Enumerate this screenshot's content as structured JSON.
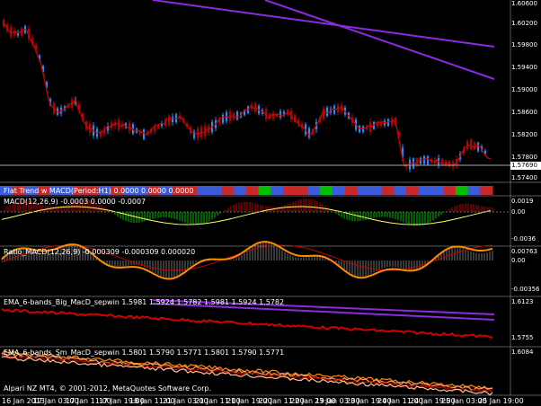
{
  "colors": {
    "background": "#000000",
    "grid": "#5a5a5a",
    "candle_up": "#1e90ff",
    "candle_down": "#b40000",
    "ma_line": "#d00000",
    "ema_band": "#8a2be2",
    "macd_hist_up": "#00c000",
    "macd_hist_down": "#c00000",
    "macd_signal": "#ffff60",
    "ratio_line": "#ff8c00",
    "ratio_signal": "#c00000",
    "flat_trend_blue": "#3c5adc",
    "flat_trend_red": "#c82828",
    "flat_trend_green": "#00c000"
  },
  "main_panel": {
    "price_scale": [
      "1.60600",
      "1.60200",
      "1.59800",
      "1.59400",
      "1.59000",
      "1.58600",
      "1.58200",
      "1.57800",
      "1.57400"
    ],
    "current_price": "1.57690"
  },
  "indicators": {
    "flat_trend": {
      "label": "Flat Trend w MACD(Period:H1) 0.0000 0.0000 0.0000"
    },
    "macd": {
      "label": "MACD(12,26,9) -0.0003 0.0000 -0.0007",
      "scale": [
        "0.0019",
        "0.00",
        "-0.0036"
      ]
    },
    "ratio_macd": {
      "label": "Ratio_MACD(12,26,9) -0.000309 -0.000309 0.000020",
      "scale": [
        "0.00763",
        "0.00",
        "-0.00356"
      ]
    },
    "ema_big": {
      "label": "EMA_6-bands_Big_MacD_sepwin  1.5981  1.5924  1.5782  1.5981  1.5924  1.5782",
      "scale": [
        "1.6123",
        "1.5755"
      ]
    },
    "ema_small": {
      "label": "EMA_6-bands_Sm_MacD_sepwin  1.5801  1.5790  1.5771  1.5801  1.5790  1.5771",
      "scale": [
        "1.6084"
      ]
    }
  },
  "copyright": "Alpari NZ MT4, © 2001-2012, MetaQuotes Software Corp.",
  "time_axis": [
    "16 Jan 2013",
    "17 Jan 03:00",
    "17 Jan 11:00",
    "17 Jan 19:00",
    "18 Jan 11:00",
    "21 Jan 03:00",
    "21 Jan 11:00",
    "21 Jan 19:00",
    "22 Jan 11:00",
    "22 Jan 19:00",
    "23 Jan 03:00",
    "23 Jan 19:00",
    "24 Jan 11:00",
    "24 Jan 19:00",
    "25 Jan 03:00",
    "25 Jan 19:00"
  ]
}
